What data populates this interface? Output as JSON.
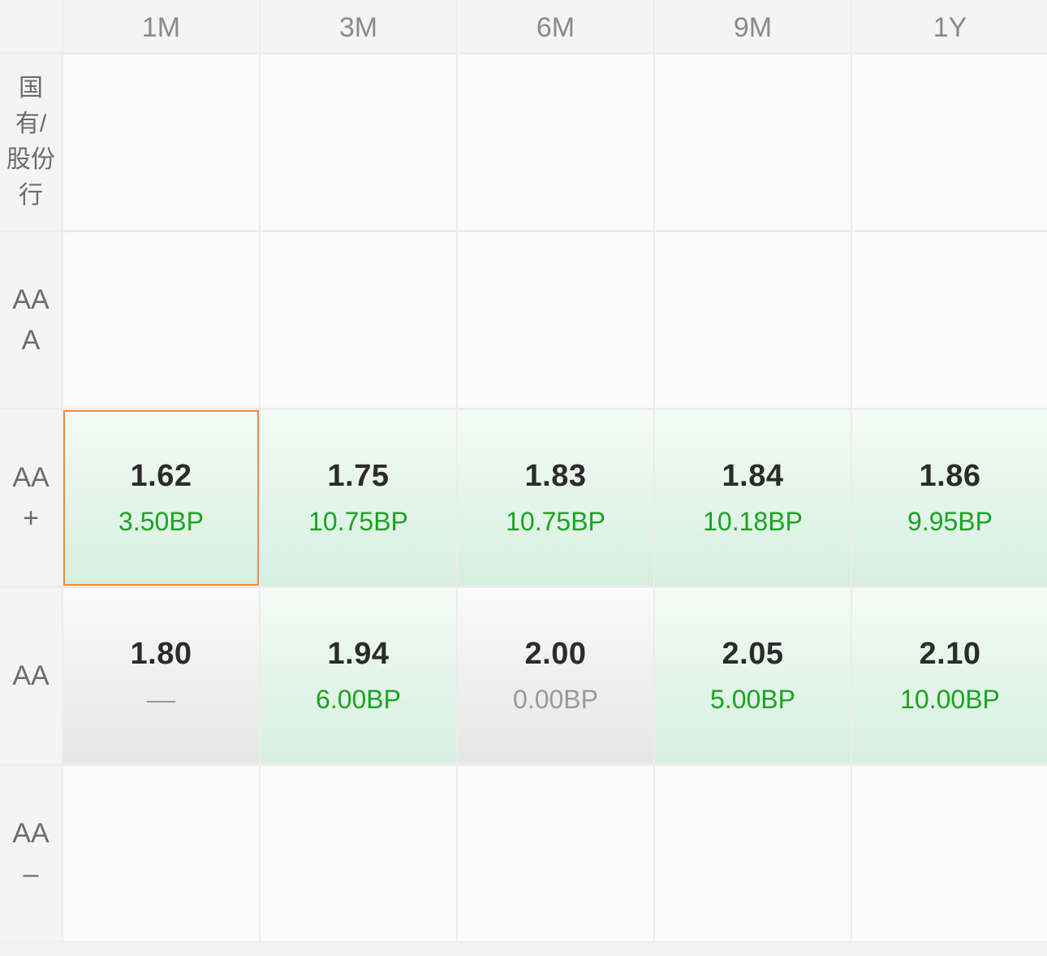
{
  "columns": [
    "1M",
    "3M",
    "6M",
    "9M",
    "1Y"
  ],
  "rows": [
    {
      "label": "国有/股份行",
      "cells": [
        null,
        null,
        null,
        null,
        null
      ]
    },
    {
      "label": "AAA",
      "cells": [
        null,
        null,
        null,
        null,
        null
      ]
    },
    {
      "label": "AA+",
      "cells": [
        {
          "price": "1.62",
          "bp": "3.50BP",
          "trend": "up",
          "selected": true
        },
        {
          "price": "1.75",
          "bp": "10.75BP",
          "trend": "up"
        },
        {
          "price": "1.83",
          "bp": "10.75BP",
          "trend": "up"
        },
        {
          "price": "1.84",
          "bp": "10.18BP",
          "trend": "up"
        },
        {
          "price": "1.86",
          "bp": "9.95BP",
          "trend": "up"
        }
      ]
    },
    {
      "label": "AA",
      "cells": [
        {
          "price": "1.80",
          "bp": "––",
          "trend": "flat"
        },
        {
          "price": "1.94",
          "bp": "6.00BP",
          "trend": "up"
        },
        {
          "price": "2.00",
          "bp": "0.00BP",
          "trend": "flat"
        },
        {
          "price": "2.05",
          "bp": "5.00BP",
          "trend": "up"
        },
        {
          "price": "2.10",
          "bp": "10.00BP",
          "trend": "up"
        }
      ]
    },
    {
      "label": "AA–",
      "cells": [
        null,
        null,
        null,
        null,
        null
      ]
    }
  ],
  "colors": {
    "up": "#1aa41f",
    "flat": "#9a9a9a",
    "selected_border": "#f08a3c"
  }
}
